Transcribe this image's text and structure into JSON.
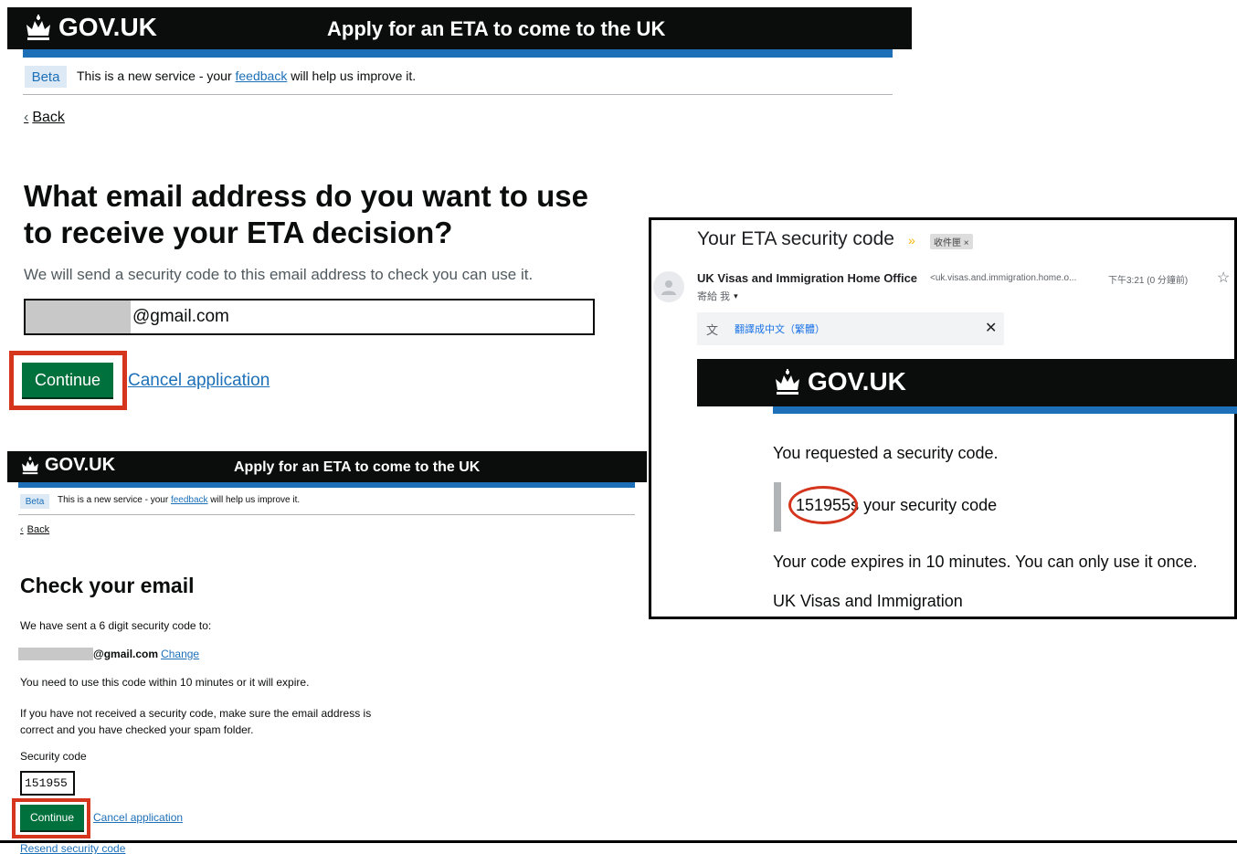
{
  "colors": {
    "gov_black": "#0b0c0c",
    "gov_blue": "#1d70b8",
    "gov_green": "#00703c",
    "annotation_red": "#d4351c",
    "beta_tag_bg": "#dde9f5"
  },
  "icons": {
    "crown": "crown-icon",
    "back": "chevron-left-icon",
    "importance": "importance-marker-icon",
    "star": "star-icon",
    "translate": "translate-icon",
    "close": "close-icon",
    "dropdown": "caret-down-icon",
    "avatar": "person-icon"
  },
  "email_page": {
    "header": {
      "logo": "GOV.UK",
      "service": "Apply for an ETA to come to the UK"
    },
    "banner": {
      "tag": "Beta",
      "text_before": "This is a new service - your ",
      "link": "feedback",
      "text_after": " will help us improve it."
    },
    "back": "Back",
    "heading_line1": "What email address do you want to use",
    "heading_line2": "to receive your ETA decision?",
    "hint": "We will send a security code to this email address to check you can use it.",
    "email_value": "@gmail.com",
    "continue": "Continue",
    "cancel": "Cancel application"
  },
  "check_page": {
    "header": {
      "logo": "GOV.UK",
      "service": "Apply for an ETA to come to the UK"
    },
    "banner": {
      "tag": "Beta",
      "text_before": "This is a new service - your ",
      "link": "feedback",
      "text_after": " will help us improve it."
    },
    "back": "Back",
    "heading": "Check your email",
    "sent_text": "We have sent a 6 digit security code to:",
    "email_value": "@gmail.com",
    "change": "Change",
    "expiry_text": "You need to use this code within 10 minutes or it will expire.",
    "not_received_line1": "If you have not received a security code, make sure the email address is",
    "not_received_line2": "correct and you have checked your spam folder.",
    "code_label": "Security code",
    "code_value": "151955",
    "continue": "Continue",
    "cancel": "Cancel application",
    "resend": "Resend security code"
  },
  "email_message": {
    "subject": "Your ETA security code",
    "folder_chip": "收件匣 ×",
    "sender_name": "UK Visas and Immigration Home Office",
    "sender_email": "<uk.visas.and.immigration.home.o...",
    "time": "下午3:21 (0 分鐘前)",
    "to": "寄給 我",
    "translate_link": "翻譯成中文（繁體）",
    "gov_logo": "GOV.UK",
    "line_requested": "You requested a security code.",
    "code": "151955",
    "code_suffix": "s your security code",
    "line_expires": "Your code expires in 10 minutes. You can only use it once.",
    "signoff": "UK Visas and Immigration"
  }
}
